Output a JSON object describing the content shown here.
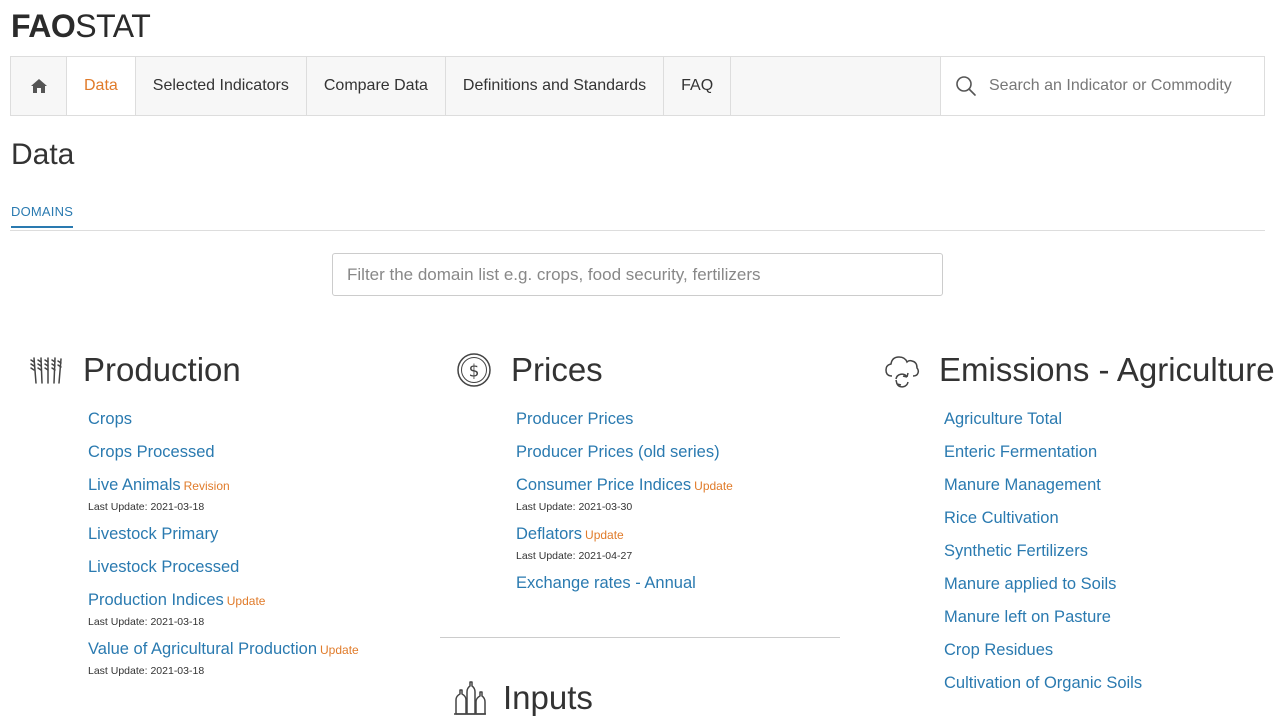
{
  "logo": {
    "bold": "FAO",
    "regular": "STAT"
  },
  "nav": {
    "items": [
      "Data",
      "Selected Indicators",
      "Compare Data",
      "Definitions and Standards",
      "FAQ"
    ],
    "search_placeholder": "Search an Indicator or Commodity"
  },
  "page": {
    "title": "Data",
    "tab": "DOMAINS",
    "filter_placeholder": "Filter the domain list e.g. crops, food security, fertilizers"
  },
  "columns": {
    "production": {
      "title": "Production",
      "links": [
        {
          "label": "Crops"
        },
        {
          "label": "Crops Processed"
        },
        {
          "label": "Live Animals",
          "badge": "Revision",
          "last_update": "Last Update: 2021-03-18"
        },
        {
          "label": "Livestock Primary"
        },
        {
          "label": "Livestock Processed"
        },
        {
          "label": "Production Indices",
          "badge": "Update",
          "last_update": "Last Update: 2021-03-18"
        },
        {
          "label": "Value of Agricultural Production",
          "badge": "Update",
          "last_update": "Last Update: 2021-03-18"
        }
      ]
    },
    "prices": {
      "title": "Prices",
      "links": [
        {
          "label": "Producer Prices"
        },
        {
          "label": "Producer Prices (old series)"
        },
        {
          "label": "Consumer Price Indices",
          "badge": "Update",
          "last_update": "Last Update: 2021-03-30"
        },
        {
          "label": "Deflators",
          "badge": "Update",
          "last_update": "Last Update: 2021-04-27"
        },
        {
          "label": "Exchange rates - Annual"
        }
      ]
    },
    "emissions": {
      "title": "Emissions - Agriculture",
      "links": [
        {
          "label": "Agriculture Total"
        },
        {
          "label": "Enteric Fermentation"
        },
        {
          "label": "Manure Management"
        },
        {
          "label": "Rice Cultivation"
        },
        {
          "label": "Synthetic Fertilizers"
        },
        {
          "label": "Manure applied to Soils"
        },
        {
          "label": "Manure left on Pasture"
        },
        {
          "label": "Crop Residues"
        },
        {
          "label": "Cultivation of Organic Soils"
        }
      ]
    },
    "inputs": {
      "title": "Inputs"
    }
  },
  "colors": {
    "link": "#2a7ab0",
    "accent": "#e07b2a",
    "text": "#333333"
  },
  "icons": {
    "home": "home-icon",
    "search": "search-icon",
    "production": "wheat-icon",
    "prices": "dollar-circle-icon",
    "emissions": "cloud-cycle-icon",
    "inputs": "bottles-icon"
  }
}
